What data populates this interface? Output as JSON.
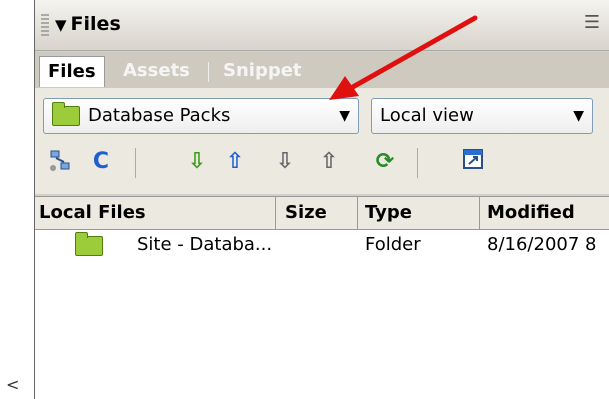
{
  "left_text": "<",
  "panel": {
    "title": "Files",
    "tabs": [
      {
        "label": "Files",
        "active": true
      },
      {
        "label": "Assets",
        "active": false
      },
      {
        "label": "Snippet",
        "active": false
      }
    ],
    "site_select": {
      "value": "Database Packs"
    },
    "view_select": {
      "value": "Local view"
    },
    "toolbar_icons": [
      "connect-icon",
      "refresh-icon",
      "get-icon",
      "put-icon",
      "checkout-icon",
      "checkin-icon",
      "synchronize-icon",
      "expand-icon"
    ],
    "columns": [
      "Local Files",
      "Size",
      "Type",
      "Modified"
    ],
    "rows": [
      {
        "name": "Site - Databa...",
        "size": "",
        "type": "Folder",
        "modified": "8/16/2007 8"
      }
    ]
  },
  "colors": {
    "arrow": "#e01010",
    "folder": "#9ccc3a",
    "icon_green": "#3a9a1a",
    "icon_blue": "#1f5fcf"
  }
}
